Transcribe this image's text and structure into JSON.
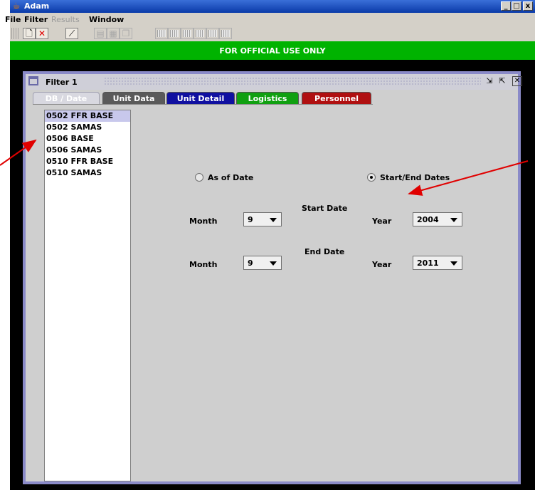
{
  "app": {
    "title": "Adam"
  },
  "window_controls": {
    "minimize": "_",
    "maximize": "□",
    "close": "x"
  },
  "menu": [
    {
      "label": "File",
      "enabled": true
    },
    {
      "label": "Filter",
      "enabled": true
    },
    {
      "label": "Results",
      "enabled": false
    },
    {
      "label": "Window",
      "enabled": true
    }
  ],
  "banner": "FOR OFFICIAL USE ONLY",
  "frame": {
    "title": "Filter 1"
  },
  "tabs": [
    {
      "label": "DB / Date",
      "color": "#d8d8e0",
      "active": true
    },
    {
      "label": "Unit Data",
      "color": "#5a5a5a"
    },
    {
      "label": "Unit Detail",
      "color": "#1010a0"
    },
    {
      "label": "Logistics",
      "color": "#10a010"
    },
    {
      "label": "Personnel",
      "color": "#b01010"
    }
  ],
  "databases": [
    "0502 FFR BASE",
    "0502 SAMAS",
    "0506 BASE",
    "0506 SAMAS",
    "0510 FFR BASE",
    "0510 SAMAS"
  ],
  "date_mode": {
    "as_of": {
      "label": "As of Date",
      "selected": false
    },
    "start_end": {
      "label": "Start/End Dates",
      "selected": true
    }
  },
  "start_date": {
    "heading": "Start Date",
    "month_label": "Month",
    "month": "9",
    "year_label": "Year",
    "year": "2004"
  },
  "end_date": {
    "heading": "End Date",
    "month_label": "Month",
    "month": "9",
    "year_label": "Year",
    "year": "2011"
  },
  "colors": {
    "banner": "#00b300",
    "annotation_arrow": "#e00000",
    "frame_border": "#8a8ac8"
  }
}
